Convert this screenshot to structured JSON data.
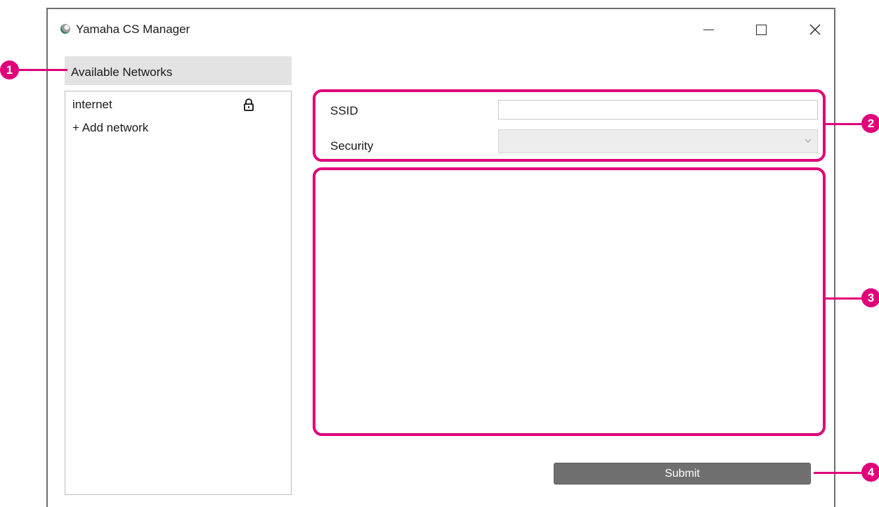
{
  "window": {
    "title": "Yamaha CS Manager",
    "icon": "yamaha-cs-manager-icon"
  },
  "networks": {
    "header": "Available Networks",
    "items": [
      {
        "label": "internet",
        "secured": true,
        "icon": "lock-icon"
      },
      {
        "label": "+ Add network"
      }
    ]
  },
  "form": {
    "ssid_label": "SSID",
    "ssid_value": "",
    "security_label": "Security",
    "security_value": "",
    "submit_label": "Submit"
  },
  "callouts": [
    {
      "number": "1",
      "target": "networks"
    },
    {
      "number": "2",
      "target": "ssid-security-fields"
    },
    {
      "number": "3",
      "target": "details-area"
    },
    {
      "number": "4",
      "target": "submit-button"
    }
  ],
  "colors": {
    "accent": "#e0007a",
    "submit_button": "#6f6f6f",
    "panel_header": "#e3e3e3"
  }
}
